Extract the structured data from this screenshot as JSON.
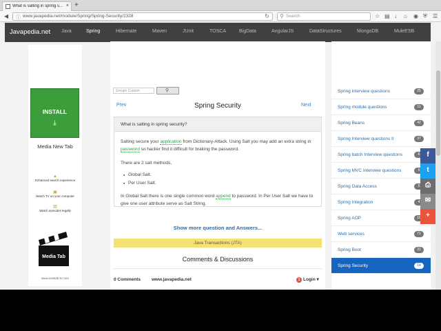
{
  "browser": {
    "tab_title": "What is salting in spring s...",
    "tab_close": "×",
    "new_tab": "+",
    "url": "www.javapedia.net/module/Spring/Spring-Security/2328",
    "search_placeholder": "Search"
  },
  "site": {
    "logo": "Javapedia.net",
    "menu": [
      "Java",
      "Spring",
      "Hibernate",
      "Maven",
      "JUnit",
      "TOSCA",
      "BigData",
      "AngularJS",
      "DataStructures",
      "MongoDB",
      "MuleESB"
    ],
    "active_menu": "Spring"
  },
  "ad": {
    "install_label": "INSTALL",
    "title": "Media New Tab",
    "features": [
      "Enhanced search experience",
      "Watch TV on your computer",
      "Watch episodes legally"
    ],
    "clapper_text": "Media Tab",
    "footer_url": "www.newtab-tv.com"
  },
  "search": {
    "placeholder": "Google Custom",
    "button_icon": "search-icon"
  },
  "page": {
    "prev": "Prev",
    "title": "Spring Security",
    "next": "Next",
    "question": "What is salting in spring security?",
    "answer": {
      "p1_a": "Salting secure your ",
      "p1_link1": "application",
      "p1_b": " from Dictionary-Attack. Using Salt you may add an extra string in ",
      "p1_link2": "password",
      "p1_c": " so hacker find it difficult for braking the password.",
      "p2": "There are 2 salt methods,",
      "bullets": [
        "Global Salt.",
        "Per User Salt."
      ],
      "p3_a": "In Global Salt there is one single common word ",
      "p3_link": "append",
      "p3_b": " to password. In Per User Salt we have to give one user attribute serve as Salt String."
    },
    "show_more": "Show more question and Answers...",
    "banner": "Java Transactions (JTA)",
    "comments_heading": "Comments & Discussions",
    "comments_count": "0 Comments",
    "comments_site": "www.javapedia.net",
    "login_badge": "1",
    "login": "Login"
  },
  "sidebar": [
    {
      "label": "Spring interview questions",
      "count": "25"
    },
    {
      "label": "Spring module questions",
      "count": "11"
    },
    {
      "label": "Spring Beans",
      "count": "42"
    },
    {
      "label": "Spring Interview questions II",
      "count": "37"
    },
    {
      "label": "Spring batch Interview questions",
      "count": "6"
    },
    {
      "label": "Spring MVC Interview questions",
      "count": "5"
    },
    {
      "label": "Spring Data Access",
      "count": "5"
    },
    {
      "label": "Spring Integration",
      "count": "4"
    },
    {
      "label": "Spring AOP",
      "count": "10"
    },
    {
      "label": "Web services",
      "count": "71"
    },
    {
      "label": "Spring Boot",
      "count": "31"
    },
    {
      "label": "Spring Security",
      "count": "14",
      "active": true
    }
  ],
  "share": [
    {
      "icon": "facebook-icon",
      "glyph": "f",
      "color": "#3b5998"
    },
    {
      "icon": "twitter-icon",
      "glyph": "t",
      "color": "#1da1f2"
    },
    {
      "icon": "print-icon",
      "glyph": "⎙",
      "color": "#6d6d6d"
    },
    {
      "icon": "email-icon",
      "glyph": "✉",
      "color": "#8a8a8a"
    },
    {
      "icon": "more-share-icon",
      "glyph": "+",
      "color": "#e8553c"
    }
  ]
}
